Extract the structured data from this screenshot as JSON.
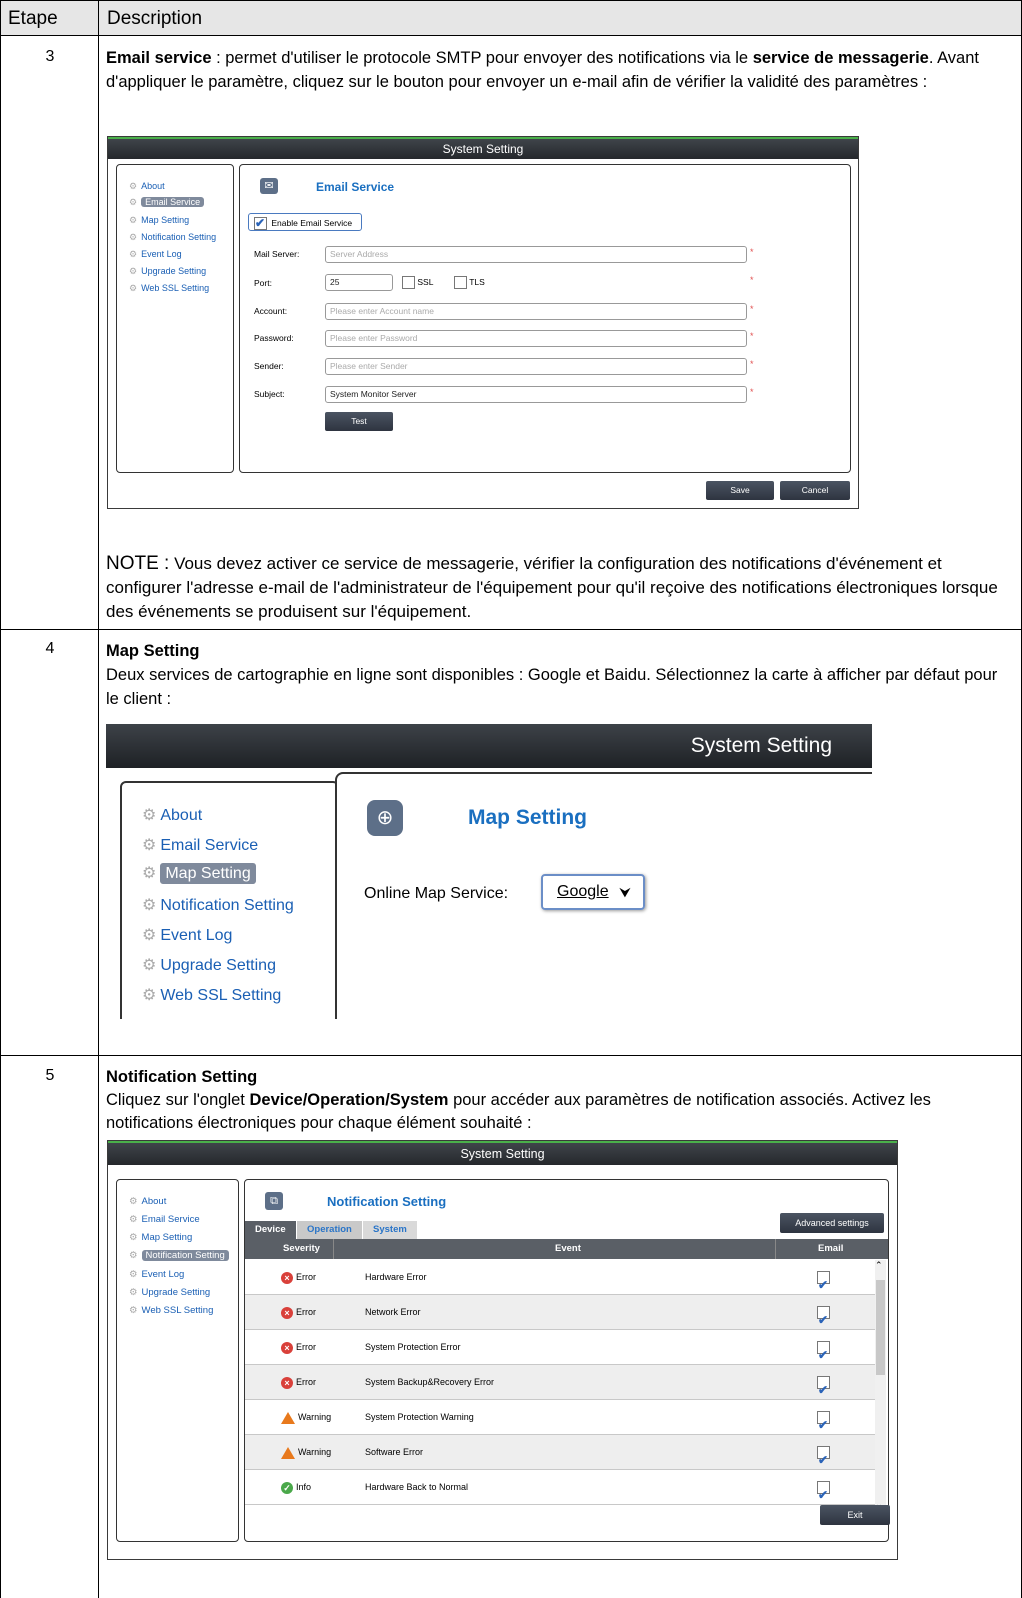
{
  "table": {
    "col_step": "Etape",
    "col_desc": "Description"
  },
  "step3": {
    "num": "3",
    "bold1": "Email service",
    "text1": " : permet d'utiliser le protocole SMTP pour envoyer des notifications via le ",
    "bold2": "service de messagerie",
    "text2": ". Avant d'appliquer le paramètre, cliquez sur le bouton pour envoyer un e-mail afin de vérifier la validité des paramètres :",
    "note_label": "NOTE :",
    "note_text": " Vous devez activer ce service de messagerie, vérifier la configuration des notifications d'événement et configurer l'adresse e-mail de l'administrateur de l'équipement pour qu'il reçoive des notifications électroniques lorsque des événements se produisent sur l'équipement.",
    "screenshot": {
      "window_title": "System Setting",
      "sidebar": [
        "About",
        "Email Service",
        "Map Setting",
        "Notification Setting",
        "Event Log",
        "Upgrade Setting",
        "Web SSL Setting"
      ],
      "selected": "Email Service",
      "section_title": "Email Service",
      "enable_label": "Enable Email Service",
      "fields": {
        "mail_server_label": "Mail Server:",
        "mail_server_placeholder": "Server Address",
        "port_label": "Port:",
        "port_value": "25",
        "ssl_label": "SSL",
        "tls_label": "TLS",
        "account_label": "Account:",
        "account_placeholder": "Please enter Account name",
        "password_label": "Password:",
        "password_placeholder": "Please enter Password",
        "sender_label": "Sender:",
        "sender_placeholder": "Please enter Sender",
        "subject_label": "Subject:",
        "subject_value": "System Monitor Server",
        "required_mark": "*"
      },
      "test_button": "Test",
      "save_button": "Save",
      "cancel_button": "Cancel"
    }
  },
  "step4": {
    "num": "4",
    "title": "Map Setting",
    "text": "Deux services de cartographie en ligne sont disponibles : Google et Baidu. Sélectionnez la carte à afficher par défaut pour le client :",
    "screenshot": {
      "window_title": "System Setting",
      "sidebar": [
        "About",
        "Email Service",
        "Map Setting",
        "Notification Setting",
        "Event Log",
        "Upgrade Setting",
        "Web SSL Setting"
      ],
      "selected": "Map Setting",
      "section_title": "Map Setting",
      "field_label": "Online Map Service:",
      "selected_option": "Google"
    }
  },
  "step5": {
    "num": "5",
    "title": "Notification Setting",
    "text1": "Cliquez sur l'onglet ",
    "bold": "Device/Operation/System",
    "text2": " pour accéder aux paramètres de notification associés. Activez les notifications électroniques pour chaque élément souhaité :",
    "screenshot": {
      "window_title": "System Setting",
      "sidebar": [
        "About",
        "Email Service",
        "Map Setting",
        "Notification Setting",
        "Event Log",
        "Upgrade Setting",
        "Web SSL Setting"
      ],
      "selected": "Notification Setting",
      "section_title": "Notification Setting",
      "tabs": [
        "Device",
        "Operation",
        "System"
      ],
      "advanced_button": "Advanced settings",
      "columns": [
        "Severity",
        "Event",
        "Email"
      ],
      "rows": [
        {
          "severity": "Error",
          "event": "Hardware Error",
          "email": true
        },
        {
          "severity": "Error",
          "event": "Network Error",
          "email": true
        },
        {
          "severity": "Error",
          "event": "System Protection Error",
          "email": true
        },
        {
          "severity": "Error",
          "event": "System Backup&Recovery Error",
          "email": true
        },
        {
          "severity": "Warning",
          "event": "System Protection Warning",
          "email": true
        },
        {
          "severity": "Warning",
          "event": "Software Error",
          "email": true
        },
        {
          "severity": "Info",
          "event": "Hardware Back to Normal",
          "email": true
        }
      ],
      "exit_button": "Exit"
    }
  },
  "colors": {
    "header_bg": "#e6e6e6",
    "link_blue": "#1a5fb4",
    "error_red": "#d9403a",
    "warning_orange": "#e8791c",
    "info_green": "#4aa84a"
  }
}
